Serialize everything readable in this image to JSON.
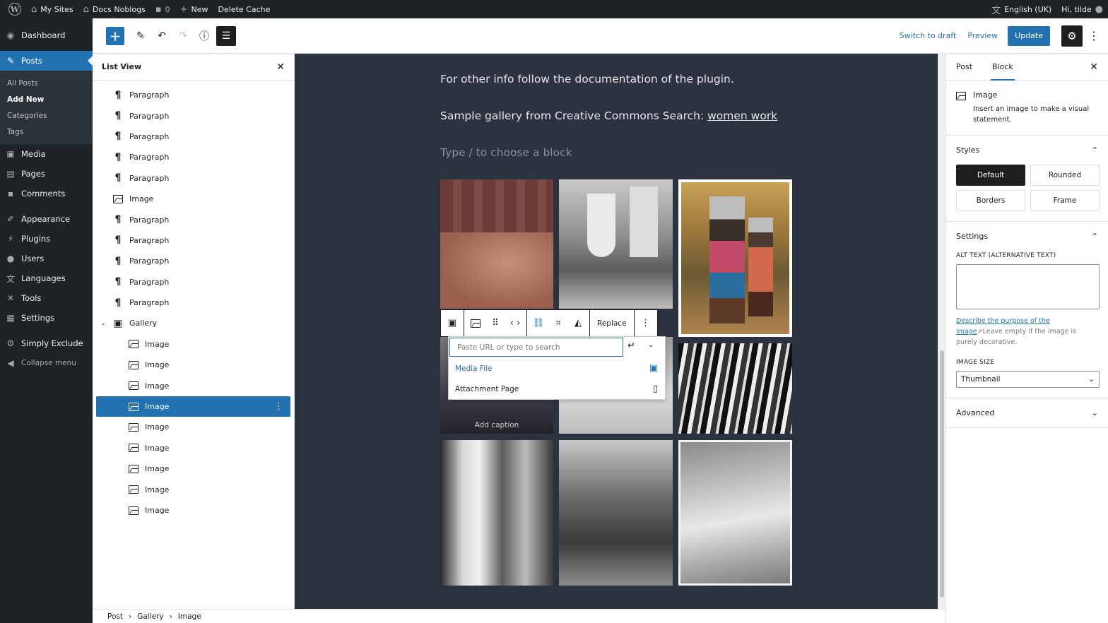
{
  "adminbar": {
    "my_sites": "My Sites",
    "site_name": "Docs Noblogs",
    "comments_count": "0",
    "new": "New",
    "delete_cache": "Delete Cache",
    "language": "English (UK)",
    "greeting": "Hi, tilde"
  },
  "menu": {
    "dashboard": "Dashboard",
    "posts": "Posts",
    "sub": [
      "All Posts",
      "Add New",
      "Categories",
      "Tags"
    ],
    "media": "Media",
    "pages": "Pages",
    "comments": "Comments",
    "appearance": "Appearance",
    "plugins": "Plugins",
    "users": "Users",
    "languages": "Languages",
    "tools": "Tools",
    "settings": "Settings",
    "simply_exclude": "Simply Exclude",
    "collapse": "Collapse menu"
  },
  "header": {
    "switch_draft": "Switch to draft",
    "preview": "Preview",
    "update": "Update"
  },
  "listview": {
    "title": "List View",
    "items": [
      {
        "label": "Paragraph",
        "type": "paragraph"
      },
      {
        "label": "Paragraph",
        "type": "paragraph"
      },
      {
        "label": "Paragraph",
        "type": "paragraph"
      },
      {
        "label": "Paragraph",
        "type": "paragraph"
      },
      {
        "label": "Paragraph",
        "type": "paragraph"
      },
      {
        "label": "Image",
        "type": "image"
      },
      {
        "label": "Paragraph",
        "type": "paragraph"
      },
      {
        "label": "Paragraph",
        "type": "paragraph"
      },
      {
        "label": "Paragraph",
        "type": "paragraph"
      },
      {
        "label": "Paragraph",
        "type": "paragraph"
      },
      {
        "label": "Paragraph",
        "type": "paragraph"
      },
      {
        "label": "Gallery",
        "type": "gallery"
      },
      {
        "label": "Image",
        "type": "image"
      },
      {
        "label": "Image",
        "type": "image"
      },
      {
        "label": "Image",
        "type": "image"
      },
      {
        "label": "Image",
        "type": "image"
      },
      {
        "label": "Image",
        "type": "image"
      },
      {
        "label": "Image",
        "type": "image"
      },
      {
        "label": "Image",
        "type": "image"
      },
      {
        "label": "Image",
        "type": "image"
      },
      {
        "label": "Image",
        "type": "image"
      }
    ]
  },
  "canvas": {
    "line1": "For other info follow the documentation of the plugin.",
    "line2_prefix": "Sample gallery from Creative Commons Search: ",
    "line2_link": "women work",
    "placeholder": "Type / to choose a block",
    "caption_placeholder": "Add caption"
  },
  "toolbar": {
    "replace": "Replace"
  },
  "linkpopover": {
    "placeholder": "Paste URL or type to search",
    "media_file": "Media File",
    "attachment_page": "Attachment Page"
  },
  "sidebar": {
    "tab_post": "Post",
    "tab_block": "Block",
    "block_name": "Image",
    "block_desc": "Insert an image to make a visual statement.",
    "styles_title": "Styles",
    "styles": [
      "Default",
      "Rounded",
      "Borders",
      "Frame"
    ],
    "settings_title": "Settings",
    "alt_label": "ALT TEXT (ALTERNATIVE TEXT)",
    "alt_help_link": "Describe the purpose of the image",
    "alt_help_rest": "Leave empty if the image is purely decorative.",
    "size_label": "IMAGE SIZE",
    "size_value": "Thumbnail",
    "advanced": "Advanced"
  },
  "breadcrumb": [
    "Post",
    "Gallery",
    "Image"
  ],
  "colors": {
    "accent": "#2271b1",
    "admin_dark": "#1d2327",
    "canvas_bg": "#2c3340"
  }
}
